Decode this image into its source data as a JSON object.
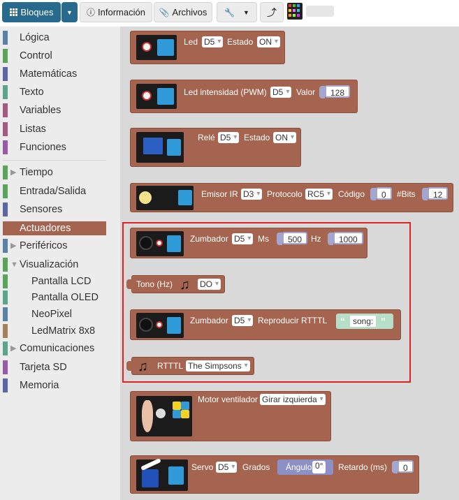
{
  "toolbar": {
    "bloques": "Bloques",
    "informacion": "Información",
    "archivos": "Archivos"
  },
  "sidebar": {
    "categories": [
      {
        "label": "Lógica",
        "color": "#5b80a5"
      },
      {
        "label": "Control",
        "color": "#5ba55b"
      },
      {
        "label": "Matemáticas",
        "color": "#5b67a5"
      },
      {
        "label": "Texto",
        "color": "#5ba58c"
      },
      {
        "label": "Variables",
        "color": "#a55b80"
      },
      {
        "label": "Listas",
        "color": "#a55b80"
      },
      {
        "label": "Funciones",
        "color": "#995ba5"
      },
      {
        "label": "Tiempo",
        "color": "#5ba55b"
      },
      {
        "label": "Entrada/Salida",
        "color": "#5ba55b"
      },
      {
        "label": "Sensores",
        "color": "#5b67a5"
      },
      {
        "label": "Actuadores",
        "color": "#a5644f"
      },
      {
        "label": "Periféricos",
        "color": "#5b80a5"
      },
      {
        "label": "Visualización",
        "color": "#5ba55b"
      },
      {
        "label": "Pantalla LCD",
        "color": "#5ba55b"
      },
      {
        "label": "Pantalla OLED",
        "color": "#5ba58c"
      },
      {
        "label": "NeoPixel",
        "color": "#5b80a5"
      },
      {
        "label": "LedMatrix 8x8",
        "color": "#a5805b"
      },
      {
        "label": "Comunicaciones",
        "color": "#5ba58c"
      },
      {
        "label": "Tarjeta SD",
        "color": "#995ba5"
      },
      {
        "label": "Memoria",
        "color": "#5b67a5"
      }
    ],
    "selected": "Actuadores"
  },
  "blocks": {
    "led": {
      "label": "Led",
      "pin": "D5",
      "estado_label": "Estado",
      "estado": "ON"
    },
    "led_pwm": {
      "label": "Led intensidad (PWM)",
      "pin": "D5",
      "valor_label": "Valor",
      "valor": "128"
    },
    "rele": {
      "label": "Relé",
      "pin": "D5",
      "estado_label": "Estado",
      "estado": "ON"
    },
    "ir": {
      "label": "Emisor IR",
      "pin": "D3",
      "protocolo_label": "Protocolo",
      "protocolo": "RC5",
      "codigo_label": "Código",
      "codigo": "0",
      "bits_label": "#Bits",
      "bits": "12"
    },
    "zumbador": {
      "label": "Zumbador",
      "pin": "D5",
      "ms_label": "Ms",
      "ms": "500",
      "hz_label": "Hz",
      "hz": "1000"
    },
    "tono": {
      "label": "Tono (Hz)",
      "note": "DO"
    },
    "rtttl_play": {
      "label": "Zumbador",
      "pin": "D5",
      "reproducir_label": "Reproducir RTTTL",
      "song": "song:"
    },
    "rtttl": {
      "label": "RTTTL",
      "song": "The Simpsons"
    },
    "motor": {
      "label": "Motor ventilador",
      "dir": "Girar izquierda"
    },
    "servo": {
      "label": "Servo",
      "pin": "D5",
      "grados_label": "Grados",
      "angulo_label": "Ángulo",
      "angulo": "0°",
      "retardo_label": "Retardo (ms)",
      "retardo": "0"
    }
  }
}
